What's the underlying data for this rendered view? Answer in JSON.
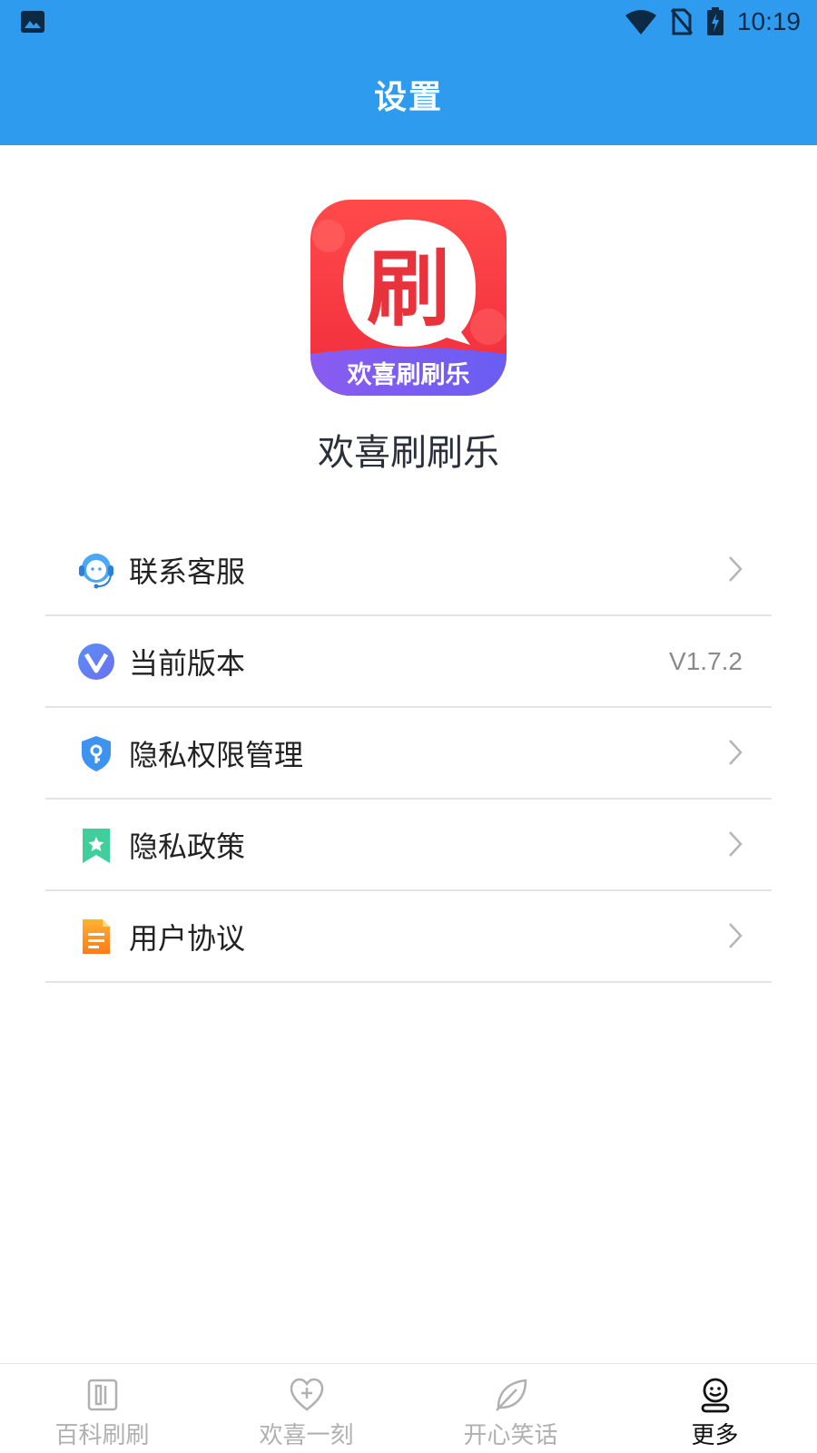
{
  "status_bar": {
    "time": "10:19"
  },
  "header": {
    "title": "设置"
  },
  "app": {
    "logo_text": "欢喜刷刷乐",
    "logo_glyph": "刷",
    "name": "欢喜刷刷乐"
  },
  "menu": [
    {
      "label": "联系客服",
      "icon": "headset-icon"
    },
    {
      "label": "当前版本",
      "icon": "version-icon",
      "value": "V1.7.2"
    },
    {
      "label": "隐私权限管理",
      "icon": "shield-key-icon"
    },
    {
      "label": "隐私政策",
      "icon": "bookmark-star-icon"
    },
    {
      "label": "用户协议",
      "icon": "document-icon"
    }
  ],
  "tabs": [
    {
      "label": "百科刷刷",
      "icon": "book-icon",
      "active": false
    },
    {
      "label": "欢喜一刻",
      "icon": "heart-plus-icon",
      "active": false
    },
    {
      "label": "开心笑话",
      "icon": "leaf-icon",
      "active": false
    },
    {
      "label": "更多",
      "icon": "smiley-user-icon",
      "active": true
    }
  ],
  "colors": {
    "primary": "#2f9bef",
    "logo_red": "#f5383a",
    "logo_purple": "#7b5cf0"
  }
}
